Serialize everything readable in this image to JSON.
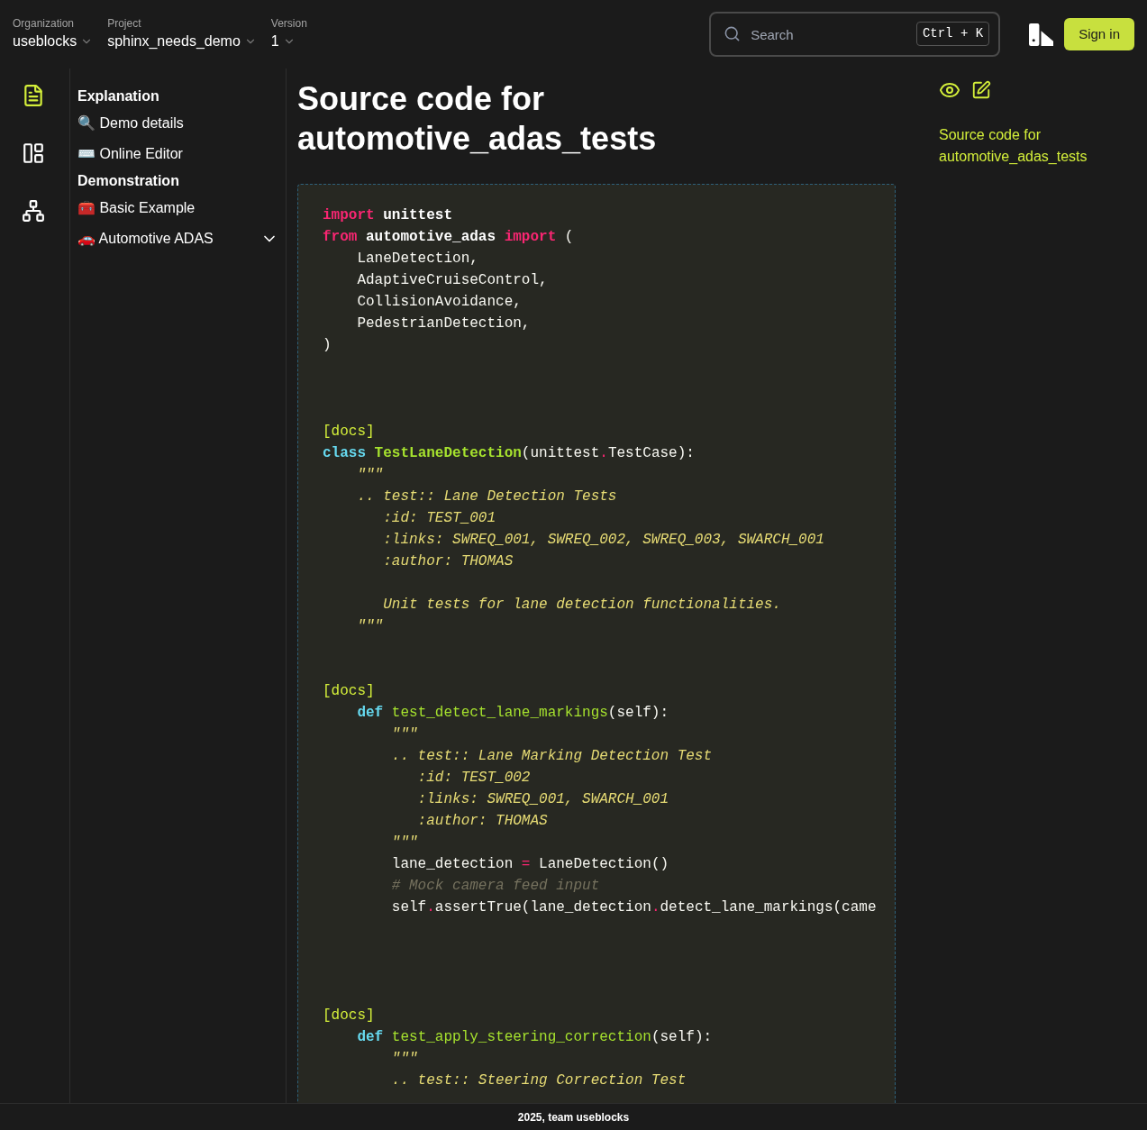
{
  "header": {
    "selectors": [
      {
        "label": "Organization",
        "value": "useblocks"
      },
      {
        "label": "Project",
        "value": "sphinx_needs_demo"
      },
      {
        "label": "Version",
        "value": "1"
      }
    ],
    "search": {
      "placeholder": "Search",
      "shortcut": "Ctrl + K"
    },
    "sign_in": "Sign in"
  },
  "rail": [
    {
      "kind": "document",
      "selected": true
    },
    {
      "kind": "layout",
      "selected": false
    },
    {
      "kind": "hierarchy",
      "selected": false
    }
  ],
  "sidebar": {
    "sections": [
      {
        "title": "Explanation",
        "items": [
          {
            "label": "🔍 Demo details",
            "expandable": false
          },
          {
            "label": "⌨️ Online Editor",
            "expandable": false
          }
        ]
      },
      {
        "title": "Demonstration",
        "items": [
          {
            "label": "🧰 Basic Example",
            "expandable": false
          },
          {
            "label": "🚗 Automotive ADAS",
            "expandable": true
          }
        ]
      }
    ]
  },
  "page_title": "Source code for automotive_adas_tests",
  "code": [
    {
      "kind": "code",
      "tokens": [
        {
          "kind": "keyword",
          "text": "import"
        },
        {
          "kind": "namespace",
          "text": " unittest"
        }
      ]
    },
    {
      "kind": "code",
      "tokens": [
        {
          "kind": "keyword",
          "text": "from"
        },
        {
          "kind": "namespace",
          "text": " automotive_adas "
        },
        {
          "kind": "keyword",
          "text": "import"
        },
        {
          "kind": "text",
          "text": " ("
        }
      ]
    },
    {
      "kind": "code",
      "tokens": [
        {
          "kind": "text",
          "text": "    LaneDetection,"
        }
      ]
    },
    {
      "kind": "code",
      "tokens": [
        {
          "kind": "text",
          "text": "    AdaptiveCruiseControl,"
        }
      ]
    },
    {
      "kind": "code",
      "tokens": [
        {
          "kind": "text",
          "text": "    CollisionAvoidance,"
        }
      ]
    },
    {
      "kind": "code",
      "tokens": [
        {
          "kind": "text",
          "text": "    PedestrianDetection,"
        }
      ]
    },
    {
      "kind": "code",
      "tokens": [
        {
          "kind": "text",
          "text": ")"
        }
      ]
    },
    {
      "kind": "blank"
    },
    {
      "kind": "blank"
    },
    {
      "kind": "blank"
    },
    {
      "kind": "link",
      "text": "[docs]"
    },
    {
      "kind": "code",
      "tokens": [
        {
          "kind": "decl",
          "text": "class"
        },
        {
          "kind": "class_name",
          "text": " TestLaneDetection"
        },
        {
          "kind": "text",
          "text": "(unittest"
        },
        {
          "kind": "operator",
          "text": "."
        },
        {
          "kind": "text",
          "text": "TestCase):"
        }
      ]
    },
    {
      "kind": "code",
      "tokens": [
        {
          "kind": "docstring",
          "text": "    \"\"\""
        }
      ]
    },
    {
      "kind": "code",
      "tokens": [
        {
          "kind": "docstring",
          "text": "    .. test:: Lane Detection Tests"
        }
      ]
    },
    {
      "kind": "code",
      "tokens": [
        {
          "kind": "docstring",
          "text": "       :id: TEST_001"
        }
      ]
    },
    {
      "kind": "code",
      "tokens": [
        {
          "kind": "docstring",
          "text": "       :links: SWREQ_001, SWREQ_002, SWREQ_003, SWARCH_001"
        }
      ]
    },
    {
      "kind": "code",
      "tokens": [
        {
          "kind": "docstring",
          "text": "       :author: THOMAS"
        }
      ]
    },
    {
      "kind": "blank"
    },
    {
      "kind": "code",
      "tokens": [
        {
          "kind": "docstring",
          "text": "       Unit tests for lane detection functionalities."
        }
      ]
    },
    {
      "kind": "code",
      "tokens": [
        {
          "kind": "docstring",
          "text": "    \"\"\""
        }
      ]
    },
    {
      "kind": "blank"
    },
    {
      "kind": "blank"
    },
    {
      "kind": "link",
      "text": "[docs]"
    },
    {
      "kind": "code",
      "tokens": [
        {
          "kind": "decl",
          "text": "    def"
        },
        {
          "kind": "function_name",
          "text": " test_detect_lane_markings"
        },
        {
          "kind": "text",
          "text": "(self):"
        }
      ]
    },
    {
      "kind": "code",
      "tokens": [
        {
          "kind": "docstring",
          "text": "        \"\"\""
        }
      ]
    },
    {
      "kind": "code",
      "tokens": [
        {
          "kind": "docstring",
          "text": "        .. test:: Lane Marking Detection Test"
        }
      ]
    },
    {
      "kind": "code",
      "tokens": [
        {
          "kind": "docstring",
          "text": "           :id: TEST_002"
        }
      ]
    },
    {
      "kind": "code",
      "tokens": [
        {
          "kind": "docstring",
          "text": "           :links: SWREQ_001, SWARCH_001"
        }
      ]
    },
    {
      "kind": "code",
      "tokens": [
        {
          "kind": "docstring",
          "text": "           :author: THOMAS"
        }
      ]
    },
    {
      "kind": "code",
      "tokens": [
        {
          "kind": "docstring",
          "text": "        \"\"\""
        }
      ]
    },
    {
      "kind": "code",
      "tokens": [
        {
          "kind": "text",
          "text": "        lane_detection "
        },
        {
          "kind": "operator",
          "text": "="
        },
        {
          "kind": "text",
          "text": " LaneDetection()"
        }
      ]
    },
    {
      "kind": "code",
      "tokens": [
        {
          "kind": "comment",
          "text": "        # Mock camera feed input"
        }
      ]
    },
    {
      "kind": "code",
      "tokens": [
        {
          "kind": "text",
          "text": "        self"
        },
        {
          "kind": "operator",
          "text": "."
        },
        {
          "kind": "text",
          "text": "assertTrue(lane_detection"
        },
        {
          "kind": "operator",
          "text": "."
        },
        {
          "kind": "text",
          "text": "detect_lane_markings(came"
        }
      ]
    },
    {
      "kind": "blank"
    },
    {
      "kind": "blank"
    },
    {
      "kind": "blank"
    },
    {
      "kind": "blank"
    },
    {
      "kind": "link",
      "text": "[docs]"
    },
    {
      "kind": "code",
      "tokens": [
        {
          "kind": "decl",
          "text": "    def"
        },
        {
          "kind": "function_name",
          "text": " test_apply_steering_correction"
        },
        {
          "kind": "text",
          "text": "(self):"
        }
      ]
    },
    {
      "kind": "code",
      "tokens": [
        {
          "kind": "docstring",
          "text": "        \"\"\""
        }
      ]
    },
    {
      "kind": "code",
      "tokens": [
        {
          "kind": "docstring",
          "text": "        .. test:: Steering Correction Test"
        }
      ]
    }
  ],
  "toc": {
    "title": "Source code for automotive_adas_tests"
  },
  "footer": "2025, team useblocks"
}
